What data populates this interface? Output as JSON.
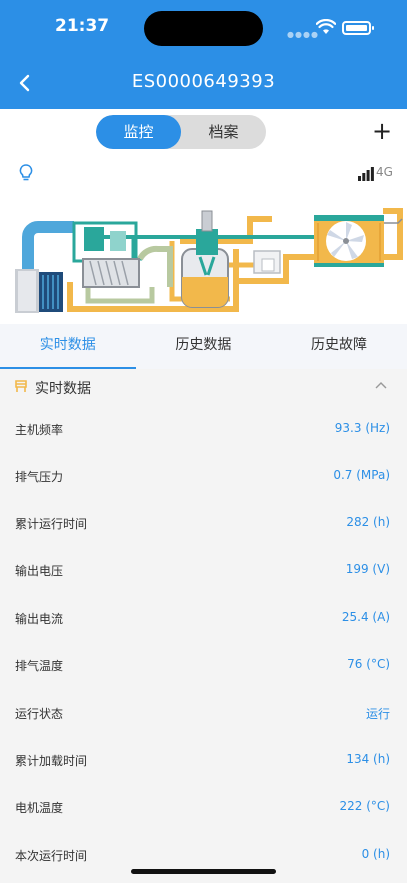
{
  "status_bar": {
    "time": "21:37"
  },
  "header": {
    "title": "ES0000649393"
  },
  "segment": {
    "monitor": "监控",
    "archive": "档案"
  },
  "network": {
    "label": "4G"
  },
  "tabs": [
    {
      "label": "实时数据"
    },
    {
      "label": "历史数据"
    },
    {
      "label": "历史故障"
    }
  ],
  "section": {
    "title": "实时数据"
  },
  "rows": [
    {
      "label": "主机频率",
      "value": "93.3 (Hz)"
    },
    {
      "label": "排气压力",
      "value": "0.7 (MPa)"
    },
    {
      "label": "累计运行时间",
      "value": "282 (h)"
    },
    {
      "label": "输出电压",
      "value": "199 (V)"
    },
    {
      "label": "输出电流",
      "value": "25.4 (A)"
    },
    {
      "label": "排气温度",
      "value": "76 (°C)"
    },
    {
      "label": "运行状态",
      "value": "运行"
    },
    {
      "label": "累计加载时间",
      "value": "134 (h)"
    },
    {
      "label": "电机温度",
      "value": "222 (°C)"
    },
    {
      "label": "本次运行时间",
      "value": "0 (h)"
    }
  ],
  "colors": {
    "primary": "#2c8fe6",
    "pipe_orange": "#f2b84b",
    "pipe_teal": "#2aa79b"
  }
}
